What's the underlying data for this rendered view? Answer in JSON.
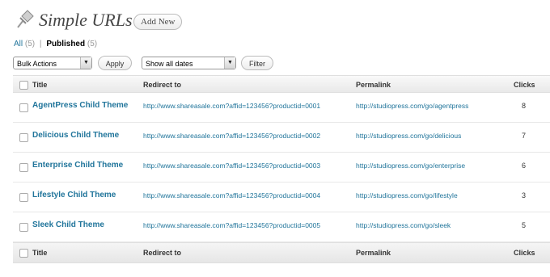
{
  "header": {
    "title": "Simple URLs",
    "add_new_label": "Add New"
  },
  "filters": {
    "all_label": "All",
    "all_count": "(5)",
    "separator": "|",
    "published_label": "Published",
    "published_count": "(5)"
  },
  "bulk": {
    "selected": "Bulk Actions",
    "apply_label": "Apply"
  },
  "dates": {
    "selected": "Show all dates",
    "filter_label": "Filter"
  },
  "columns": {
    "title": "Title",
    "redirect": "Redirect to",
    "permalink": "Permalink",
    "clicks": "Clicks"
  },
  "rows": [
    {
      "title": "AgentPress Child Theme",
      "redirect": "http://www.shareasale.com?affid=123456?productid=0001",
      "permalink": "http://studiopress.com/go/agentpress",
      "clicks": "8"
    },
    {
      "title": "Delicious Child Theme",
      "redirect": "http://www.shareasale.com?affid=123456?productid=0002",
      "permalink": "http://studiopress.com/go/delicious",
      "clicks": "7"
    },
    {
      "title": "Enterprise Child Theme",
      "redirect": "http://www.shareasale.com?affid=123456?productid=0003",
      "permalink": "http://studiopress.com/go/enterprise",
      "clicks": "6"
    },
    {
      "title": "Lifestyle Child Theme",
      "redirect": "http://www.shareasale.com?affid=123456?productid=0004",
      "permalink": "http://studiopress.com/go/lifestyle",
      "clicks": "3"
    },
    {
      "title": "Sleek Child Theme",
      "redirect": "http://www.shareasale.com?affid=123456?productid=0005",
      "permalink": "http://studiopress.com/go/sleek",
      "clicks": "5"
    }
  ],
  "colors": {
    "link": "#21759b",
    "title_text": "#464646"
  },
  "icons": {
    "header": "pushpin-icon",
    "dropdown": "chevron-down-icon"
  }
}
